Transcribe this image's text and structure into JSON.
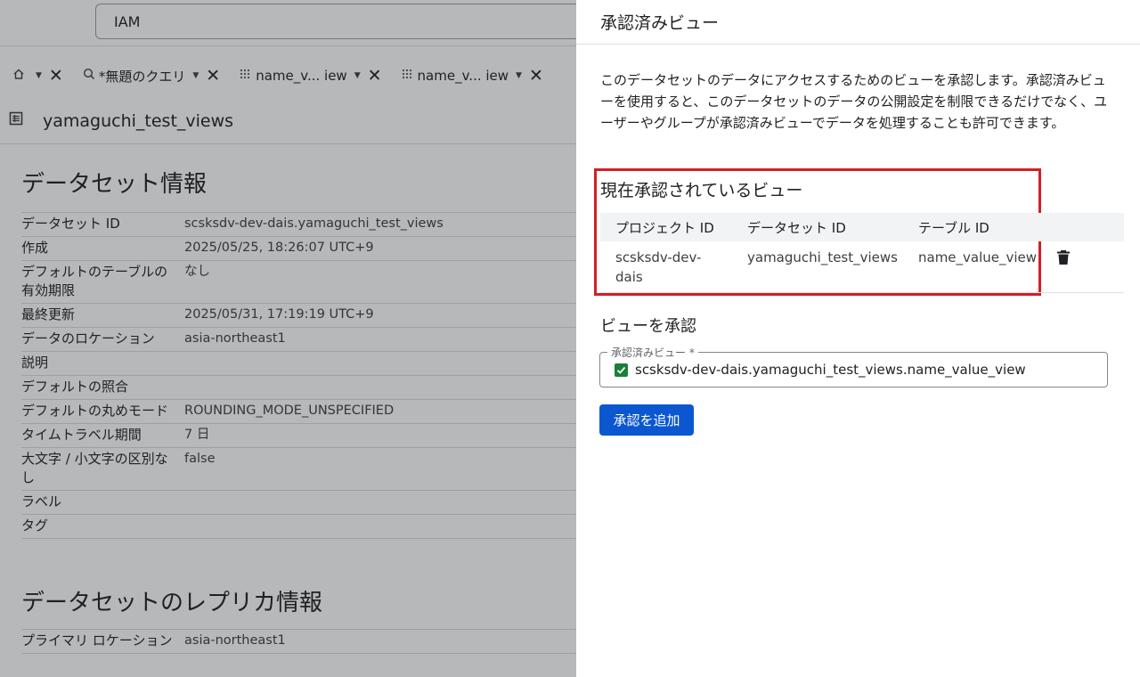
{
  "topbar": {
    "search_value": "IAM"
  },
  "tabs": [
    {
      "icon": "home-icon",
      "label": ""
    },
    {
      "icon": "query-icon",
      "label": "*無題のクエリ"
    },
    {
      "icon": "table-grid-icon",
      "label": "name_v... iew"
    },
    {
      "icon": "table-grid-icon",
      "label": "name_v... iew"
    }
  ],
  "dataset": {
    "name": "yamaguchi_test_views",
    "info_title": "データセット情報",
    "info_rows": [
      {
        "key": "データセット ID",
        "value": "scsksdv-dev-dais.yamaguchi_test_views"
      },
      {
        "key": "作成",
        "value": "2025/05/25, 18:26:07 UTC+9"
      },
      {
        "key": "デフォルトのテーブルの有効期限",
        "value": "なし"
      },
      {
        "key": "最終更新",
        "value": "2025/05/31, 17:19:19 UTC+9"
      },
      {
        "key": "データのロケーション",
        "value": "asia-northeast1"
      },
      {
        "key": "説明",
        "value": ""
      },
      {
        "key": "デフォルトの照合",
        "value": ""
      },
      {
        "key": "デフォルトの丸めモード",
        "value": "ROUNDING_MODE_UNSPECIFIED"
      },
      {
        "key": "タイムトラベル期間",
        "value": "7 日"
      },
      {
        "key": "大文字 / 小文字の区別なし",
        "value": "false"
      },
      {
        "key": "ラベル",
        "value": ""
      },
      {
        "key": "タグ",
        "value": ""
      }
    ],
    "replica_title": "データセットのレプリカ情報",
    "replica_rows": [
      {
        "key": "プライマリ ロケーション",
        "value": "asia-northeast1"
      }
    ]
  },
  "panel": {
    "title": "承認済みビュー",
    "description": "このデータセットのデータにアクセスするためのビューを承認します。承認済みビューを使用すると、このデータセットのデータの公開設定を制限できるだけでなく、ユーザーやグループが承認済みビューでデータを処理することも許可できます。",
    "current_title": "現在承認されているビュー",
    "table_headers": [
      "プロジェクト ID",
      "データセット ID",
      "テーブル ID"
    ],
    "views": [
      {
        "project": "scsksdv-dev-dais",
        "dataset": "yamaguchi_test_views",
        "table": "name_value_view"
      }
    ],
    "authorize_title": "ビューを承認",
    "field_label": "承認済みビュー *",
    "field_value": "scsksdv-dev-dais.yamaguchi_test_views.name_value_view",
    "add_button_label": "承認を追加"
  },
  "colors": {
    "primary_button": "#0b57d0",
    "highlight_border": "#d21f26",
    "check": "#188038"
  }
}
